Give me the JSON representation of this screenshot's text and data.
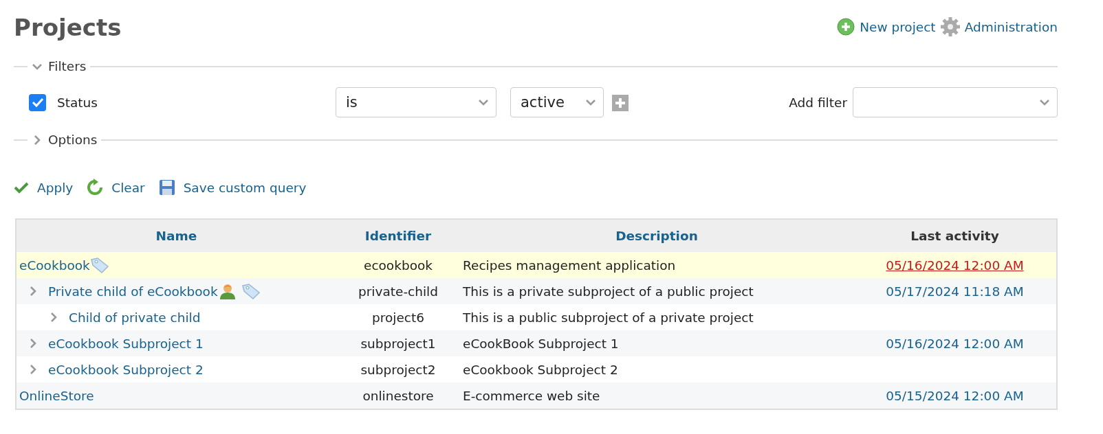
{
  "title": "Projects",
  "actions": [
    {
      "kind": "add",
      "label": "New project"
    },
    {
      "kind": "gear",
      "label": "Administration"
    }
  ],
  "filters": {
    "legend": "Filters",
    "expanded": true,
    "rows": [
      {
        "label": "Status",
        "checked": true,
        "operator": "is",
        "value": "active"
      }
    ],
    "add_filter": {
      "label": "Add filter"
    }
  },
  "options": {
    "legend": "Options",
    "expanded": false
  },
  "query_buttons": [
    {
      "kind": "check",
      "label": "Apply"
    },
    {
      "kind": "reload",
      "label": "Clear"
    },
    {
      "kind": "save",
      "label": "Save custom query"
    }
  ],
  "table": {
    "columns": [
      {
        "label": "Name",
        "sortable": true
      },
      {
        "label": "Identifier",
        "sortable": true
      },
      {
        "label": "Description",
        "sortable": true
      },
      {
        "label": "Last activity",
        "sortable": false
      }
    ],
    "rows": [
      {
        "name": "eCookbook",
        "identifier": "ecookbook",
        "description": "Recipes management application",
        "last_activity": "05/16/2024 12:00 AM",
        "highlighted": true,
        "private": false,
        "tagged": true,
        "children": [
          {
            "name": "Private child of eCookbook",
            "identifier": "private-child",
            "description": "This is a private subproject of a public project",
            "last_activity": "05/17/2024 11:18 AM",
            "highlighted": false,
            "private": true,
            "tagged": true,
            "children": [
              {
                "name": "Child of private child",
                "identifier": "project6",
                "description": "This is a public subproject of a private project",
                "highlighted": false,
                "private": false,
                "tagged": false
              }
            ]
          },
          {
            "name": "eCookbook Subproject 1",
            "identifier": "subproject1",
            "description": "eCookBook Subproject 1",
            "last_activity": "05/16/2024 12:00 AM",
            "highlighted": false,
            "private": false,
            "tagged": false
          },
          {
            "name": "eCookbook Subproject 2",
            "identifier": "subproject2",
            "description": "eCookbook Subproject 2",
            "highlighted": false,
            "private": false,
            "tagged": false
          }
        ]
      },
      {
        "name": "OnlineStore",
        "identifier": "onlinestore",
        "description": "E-commerce web site",
        "last_activity": "05/15/2024 12:00 AM",
        "highlighted": false,
        "private": false,
        "tagged": false
      }
    ]
  }
}
